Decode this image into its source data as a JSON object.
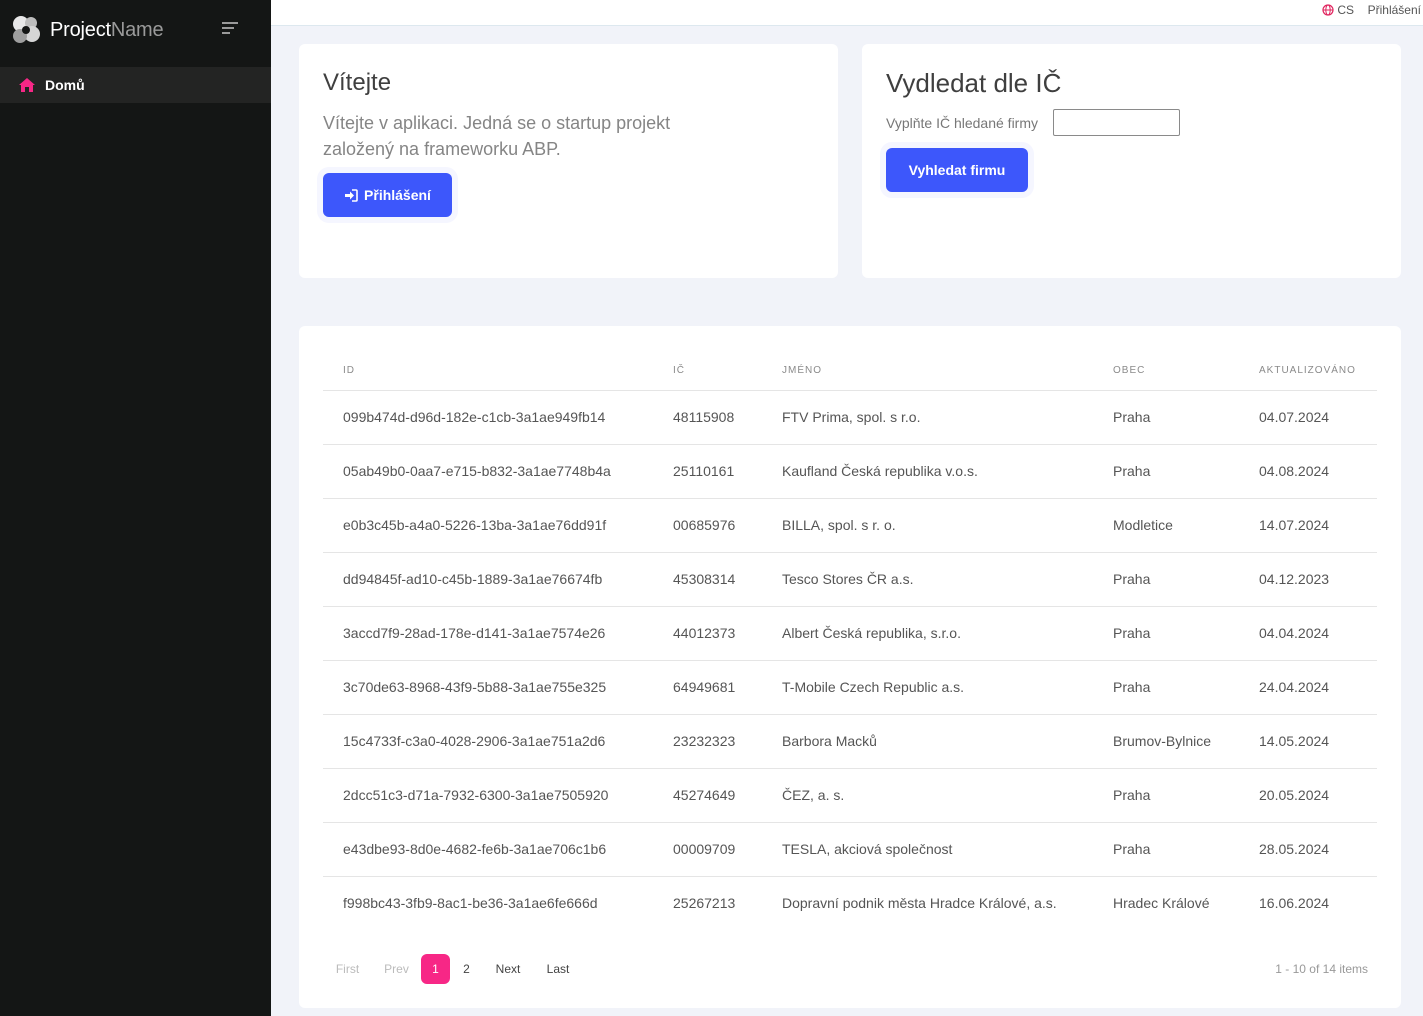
{
  "brand": {
    "name_bold": "Project",
    "name_light": "Name"
  },
  "sidebar": {
    "items": [
      {
        "label": "Domů",
        "icon": "home-icon",
        "active": true
      }
    ]
  },
  "topbar": {
    "language": "CS",
    "login": "Přihlášení"
  },
  "welcome": {
    "title": "Vítejte",
    "text": "Vítejte v aplikaci. Jedná se o startup projekt založený na frameworku ABP.",
    "button": "Přihlášení"
  },
  "search": {
    "title": "Vydledat dle IČ",
    "label": "Vyplňte IČ hledané firmy",
    "value": "",
    "button": "Vyhledat firmu"
  },
  "table": {
    "headers": [
      "ID",
      "IČ",
      "JMÉNO",
      "OBEC",
      "AKTUALIZOVÁNO"
    ],
    "rows": [
      [
        "099b474d-d96d-182e-c1cb-3a1ae949fb14",
        "48115908",
        "FTV Prima, spol. s r.o.",
        "Praha",
        "04.07.2024"
      ],
      [
        "05ab49b0-0aa7-e715-b832-3a1ae7748b4a",
        "25110161",
        "Kaufland Česká republika v.o.s.",
        "Praha",
        "04.08.2024"
      ],
      [
        "e0b3c45b-a4a0-5226-13ba-3a1ae76dd91f",
        "00685976",
        "BILLA, spol. s r. o.",
        "Modletice",
        "14.07.2024"
      ],
      [
        "dd94845f-ad10-c45b-1889-3a1ae76674fb",
        "45308314",
        "Tesco Stores ČR a.s.",
        "Praha",
        "04.12.2023"
      ],
      [
        "3accd7f9-28ad-178e-d141-3a1ae7574e26",
        "44012373",
        "Albert Česká republika, s.r.o.",
        "Praha",
        "04.04.2024"
      ],
      [
        "3c70de63-8968-43f9-5b88-3a1ae755e325",
        "64949681",
        "T-Mobile Czech Republic a.s.",
        "Praha",
        "24.04.2024"
      ],
      [
        "15c4733f-c3a0-4028-2906-3a1ae751a2d6",
        "23232323",
        "Barbora Macků",
        "Brumov-Bylnice",
        "14.05.2024"
      ],
      [
        "2dcc51c3-d71a-7932-6300-3a1ae7505920",
        "45274649",
        "ČEZ, a. s.",
        "Praha",
        "20.05.2024"
      ],
      [
        "e43dbe93-8d0e-4682-fe6b-3a1ae706c1b6",
        "00009709",
        "TESLA, akciová společnost",
        "Praha",
        "28.05.2024"
      ],
      [
        "f998bc43-3fb9-8ac1-be36-3a1ae6fe666d",
        "25267213",
        "Dopravní podnik města Hradce Králové, a.s.",
        "Hradec Králové",
        "16.06.2024"
      ]
    ]
  },
  "pager": {
    "first": "First",
    "prev": "Prev",
    "pages": [
      "1",
      "2"
    ],
    "current": "1",
    "next": "Next",
    "last": "Last",
    "info": "1 - 10 of 14 items"
  },
  "colors": {
    "sidebar": "#141615",
    "accent": "#3d57fb",
    "pink": "#f72786"
  }
}
